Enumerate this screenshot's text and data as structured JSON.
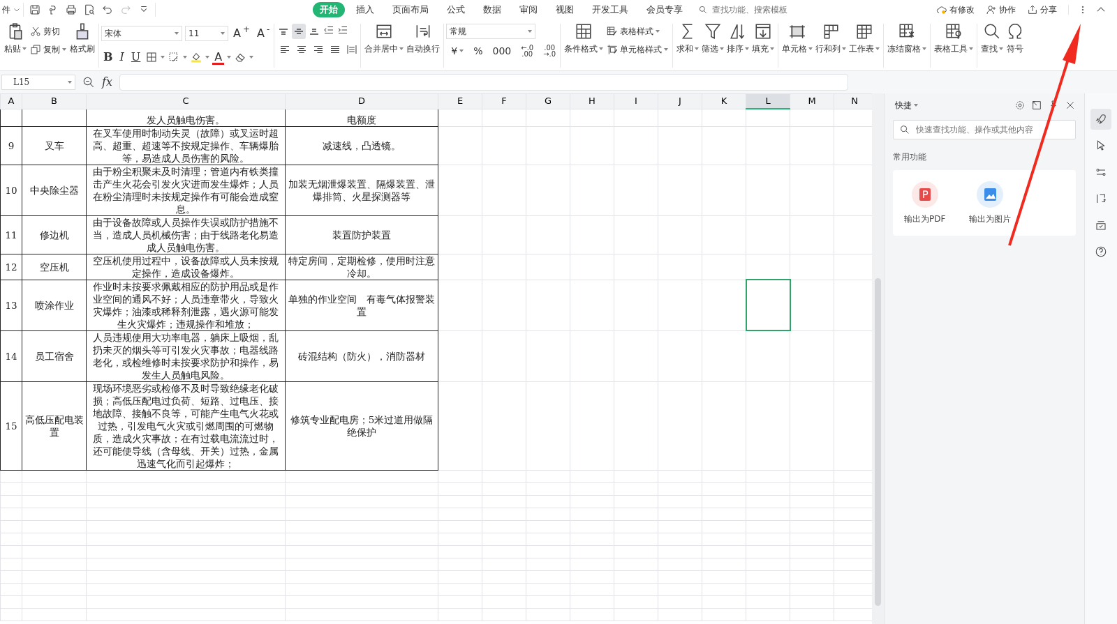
{
  "top_bar": {
    "file_menu": "件",
    "tabs": [
      {
        "label": "开始",
        "selected": true
      },
      {
        "label": "插入",
        "selected": false
      },
      {
        "label": "页面布局",
        "selected": false
      },
      {
        "label": "公式",
        "selected": false
      },
      {
        "label": "数据",
        "selected": false
      },
      {
        "label": "审阅",
        "selected": false
      },
      {
        "label": "视图",
        "selected": false
      },
      {
        "label": "开发工具",
        "selected": false
      },
      {
        "label": "会员专享",
        "selected": false
      }
    ],
    "search": {
      "placeholder": "查找功能、搜索模板"
    },
    "actions": [
      "有修改",
      "协作",
      "分享"
    ]
  },
  "ribbon": {
    "clipboard": [
      {
        "label": "粘贴",
        "dropdown": true
      },
      {
        "label": "剪切",
        "dropdown": false
      },
      {
        "label": "复制",
        "dropdown": true
      },
      {
        "label": "格式刷",
        "dropdown": false
      }
    ],
    "font": {
      "name": "宋体",
      "size": "11",
      "grow": "A$^{+}$",
      "shrink": "A$^{-}$",
      "styles": [
        "B",
        "I",
        "U"
      ],
      "color_label": "A"
    },
    "vertical_align": [
      {
        "selected": false
      },
      {
        "selected": true
      },
      {
        "selected": false
      }
    ],
    "merge": [
      {
        "label": "合并居中",
        "dropdown": true
      },
      {
        "label": "自动换行",
        "dropdown": false
      }
    ],
    "number_format": "常规",
    "number_buttons": [
      {
        "lines": [
          "¥"
        ],
        "dropdown": true
      },
      {
        "lines": [
          "%"
        ],
        "dropdown": false
      },
      {
        "lines": [
          "000"
        ],
        "dropdown": false
      },
      {
        "lines": [
          "←.0",
          ".00"
        ],
        "dropdown": false
      },
      {
        "lines": [
          ".00",
          "→.0"
        ],
        "dropdown": false
      }
    ],
    "styles": [
      {
        "label": "条件格式",
        "dropdown": true
      },
      {
        "label": "表格样式",
        "dropdown": true
      },
      {
        "label": "单元格样式",
        "dropdown": true
      }
    ],
    "tools": [
      {
        "label": "求和",
        "dropdown": true
      },
      {
        "label": "筛选",
        "dropdown": true
      },
      {
        "label": "排序",
        "dropdown": true
      },
      {
        "label": "填充",
        "dropdown": true
      },
      {
        "label": "单元格",
        "dropdown": true
      },
      {
        "label": "行和列",
        "dropdown": true
      },
      {
        "label": "工作表",
        "dropdown": true
      },
      {
        "label": "冻结窗格",
        "dropdown": true
      },
      {
        "label": "表格工具",
        "dropdown": true
      },
      {
        "label": "查找",
        "dropdown": true
      },
      {
        "label": "符号",
        "dropdown": false
      }
    ]
  },
  "formula_bar": {
    "name_box": "L15",
    "fx": "fx"
  },
  "sheet": {
    "columns": [
      {
        "label": "A",
        "selected": false
      },
      {
        "label": "B",
        "selected": false
      },
      {
        "label": "C",
        "selected": false
      },
      {
        "label": "D",
        "selected": false
      },
      {
        "label": "E",
        "selected": false
      },
      {
        "label": "F",
        "selected": false
      },
      {
        "label": "G",
        "selected": false
      },
      {
        "label": "H",
        "selected": false
      },
      {
        "label": "I",
        "selected": false
      },
      {
        "label": "J",
        "selected": false
      },
      {
        "label": "K",
        "selected": false
      },
      {
        "label": "L",
        "selected": true
      },
      {
        "label": "M",
        "selected": false
      },
      {
        "label": "N",
        "selected": false
      }
    ],
    "rows": [
      {
        "partial": true,
        "selected": false,
        "cells": [
          "",
          "",
          "发人员触电伤害。",
          "电额度"
        ]
      },
      {
        "partial": false,
        "selected": false,
        "cells": [
          "9",
          "叉车",
          "在叉车使用时制动失灵（故障）或叉运时超高、超重、超速等不按规定操作、车辆爆胎等，易造成人员伤害的风险。",
          "减速线，凸透镜。"
        ]
      },
      {
        "partial": false,
        "selected": false,
        "cells": [
          "10",
          "中央除尘器",
          "由于粉尘积聚未及时清理；管道内有铁类撞击产生火花会引发火灾进而发生爆炸；人员在粉尘清理时未按规定操作有可能会造成窒息。",
          "加装无烟泄爆装置、隔爆装置、泄爆排筒、火星探测器等"
        ]
      },
      {
        "partial": false,
        "selected": false,
        "cells": [
          "11",
          "修边机",
          "由于设备故障或人员操作失误或防护措施不当，造成人员机械伤害；由于线路老化易造成人员触电伤害。",
          "装置防护装置"
        ]
      },
      {
        "partial": false,
        "selected": false,
        "cells": [
          "12",
          "空压机",
          "空压机使用过程中，设备故障或人员未按规定操作，造成设备爆炸。",
          "特定房间，定期检修，使用时注意冷却。"
        ]
      },
      {
        "partial": false,
        "selected": true,
        "cells": [
          "13",
          "喷涂作业",
          "作业时未按要求佩戴相应的防护用品或是作业空间的通风不好；人员违章带火，导致火灾爆炸；油漆或稀释剂泄露，遇火源可能发生火灾爆炸；违规操作和堆放；",
          "单独的作业空间　有毒气体报警装置"
        ]
      },
      {
        "partial": false,
        "selected": false,
        "cells": [
          "14",
          "员工宿舍",
          "人员违规使用大功率电器，躺床上吸烟，乱扔未灭的烟头等可引发火灾事故；电器线路老化，或检维修时未按要求防护和操作，易发生人员触电风险。",
          "砖混结构（防火），消防器材"
        ]
      },
      {
        "partial": false,
        "selected": false,
        "cells": [
          "15",
          "高低压配电装置",
          "现场环境恶劣或检修不及时导致绝缘老化破损；高低压配电过负荷、短路、过电压、接地故障、接触不良等，可能产生电气火花或过热，引发电气火灾或引燃周围的可燃物质，造成火灾事故；在有过载电流流过时，还可能使导线（含母线、开关）过热，金属迅速气化而引起爆炸；",
          "修筑专业配电房；5米过道用做隔绝保护"
        ]
      }
    ]
  },
  "side_panel": {
    "title": "快捷",
    "search": {
      "placeholder": "快速查找功能、操作或其他内容"
    },
    "section": "常用功能",
    "items": [
      "输出为PDF",
      "输出为图片"
    ]
  },
  "side_strip": [
    {
      "selected": true
    },
    {
      "selected": false
    },
    {
      "selected": false
    },
    {
      "selected": false
    },
    {
      "selected": false
    },
    {
      "selected": false
    }
  ]
}
